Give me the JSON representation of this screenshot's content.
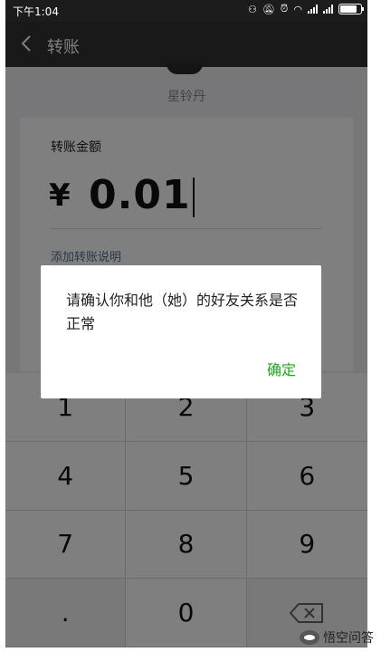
{
  "status_bar": {
    "time": "下午1:04",
    "icons": [
      "link-icon",
      "mute-icon",
      "alarm-icon",
      "wifi-icon",
      "signal-icon",
      "signal-icon",
      "battery-icon"
    ]
  },
  "title_bar": {
    "title": "转账"
  },
  "payee": {
    "name": "星铃丹"
  },
  "amount_card": {
    "label": "转账金额",
    "currency": "¥",
    "value": "0.01",
    "remark_link": "添加转账说明"
  },
  "dialog": {
    "message": "请确认你和他（她）的好友关系是否正常",
    "ok_label": "确定",
    "ok_color": "#1aad19"
  },
  "keypad": {
    "keys": [
      "1",
      "2",
      "3",
      "4",
      "5",
      "6",
      "7",
      "8",
      "9",
      ".",
      "0",
      ""
    ]
  },
  "watermark": {
    "text": "悟空问答"
  }
}
